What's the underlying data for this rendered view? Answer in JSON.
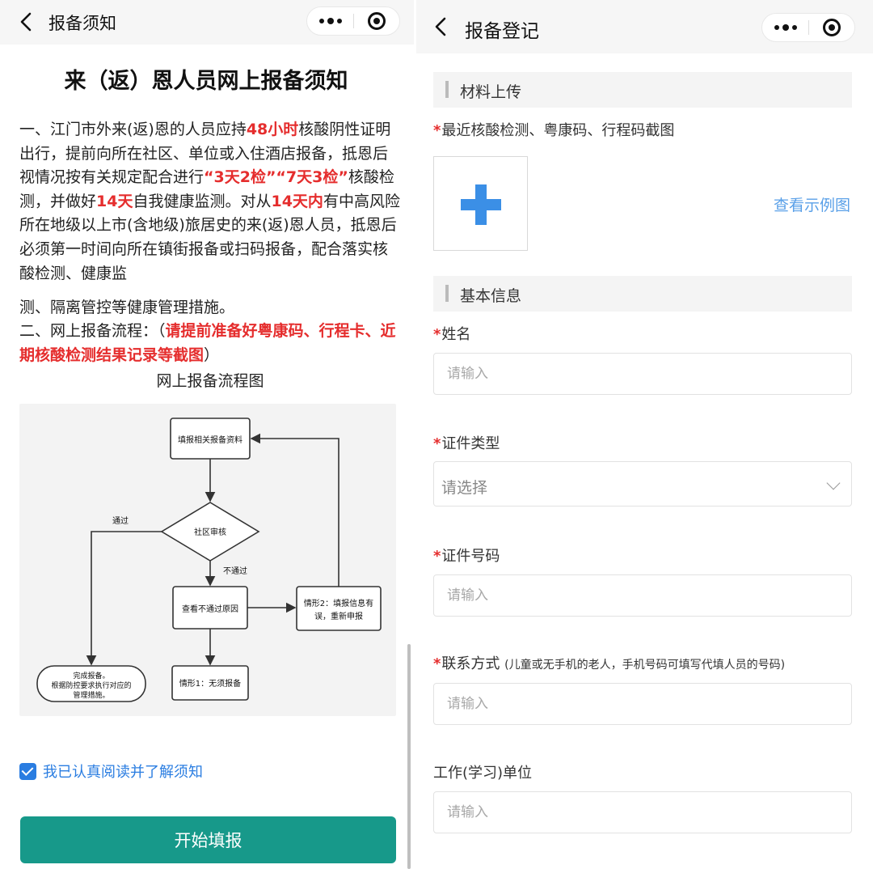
{
  "left": {
    "nav_title": "报备须知",
    "notice_title": "来（返）恩人员网上报备须知",
    "para1": [
      {
        "text": "一、江门市外来(返)恩的人员应持",
        "red": false
      },
      {
        "text": "48小时",
        "red": true
      },
      {
        "text": "核酸阴性证明出行，提前向所在社区、单位或入住酒店报备，抵恩后视情况按有关规定配合进行",
        "red": false
      },
      {
        "text": "“3天2检”“7天3检”",
        "red": true
      },
      {
        "text": "核酸检测，并做好",
        "red": false
      },
      {
        "text": "14天",
        "red": true
      },
      {
        "text": "自我健康监测。对从",
        "red": false
      },
      {
        "text": "14天内",
        "red": true
      },
      {
        "text": "有中高风险所在地级以上市(含地级)旅居史的来(返)恩人员，抵恩后必须第一时间向所在镇街报备或扫码报备，配合落实核酸检测、健康监",
        "red": false
      }
    ],
    "para2_line1": "测、隔离管控等健康管理措施。",
    "para3": [
      {
        "text": "二、网上报备流程：（",
        "red": false
      },
      {
        "text": "请提前准备好粤康码、行程卡、近期核酸检测结果记录等截图",
        "red": true
      },
      {
        "text": "）",
        "red": false
      }
    ],
    "flow_caption": "网上报备流程图",
    "flowchart": {
      "node_fill": "填报相关报备资料",
      "node_review": "社区审核",
      "label_pass": "通过",
      "label_fail": "不通过",
      "node_reason": "查看不通过原因",
      "node_case2_line1": "情形2：填报信息有",
      "node_case2_line2": "误，重新申报",
      "node_case1": "情形1：无须报备",
      "node_done_line1": "完成报备。",
      "node_done_line2": "根据防控要求执行对应的",
      "node_done_line3": "管理措施。"
    },
    "agree_label": "我已认真阅读并了解须知",
    "start_button": "开始填报"
  },
  "right": {
    "nav_title": "报备登记",
    "section_materials": "材料上传",
    "upload_label": "最近核酸检测、粤康码、行程码截图",
    "sample_link": "查看示例图",
    "section_basic": "基本信息",
    "name_label": "姓名",
    "name_placeholder": "请输入",
    "id_type_label": "证件类型",
    "id_type_value": "请选择",
    "id_number_label": "证件号码",
    "id_number_placeholder": "请输入",
    "contact_label": "联系方式",
    "contact_note": "(儿童或无手机的老人，手机号码可填写代填人员的号码)",
    "contact_placeholder": "请输入",
    "work_label": "工作(学习)单位",
    "work_placeholder": "请输入",
    "required_mark": "*"
  },
  "colors": {
    "accent_red": "#e52d2d",
    "primary_green": "#17998a",
    "link_blue": "#5aa0e8",
    "checkbox_blue": "#2a7de1",
    "upload_plus": "#3b8fe6"
  },
  "icons": [
    "back-arrow-icon",
    "more-dots-icon",
    "target-circle-icon",
    "checkbox-checked-icon",
    "plus-icon",
    "chevron-down-icon"
  ]
}
